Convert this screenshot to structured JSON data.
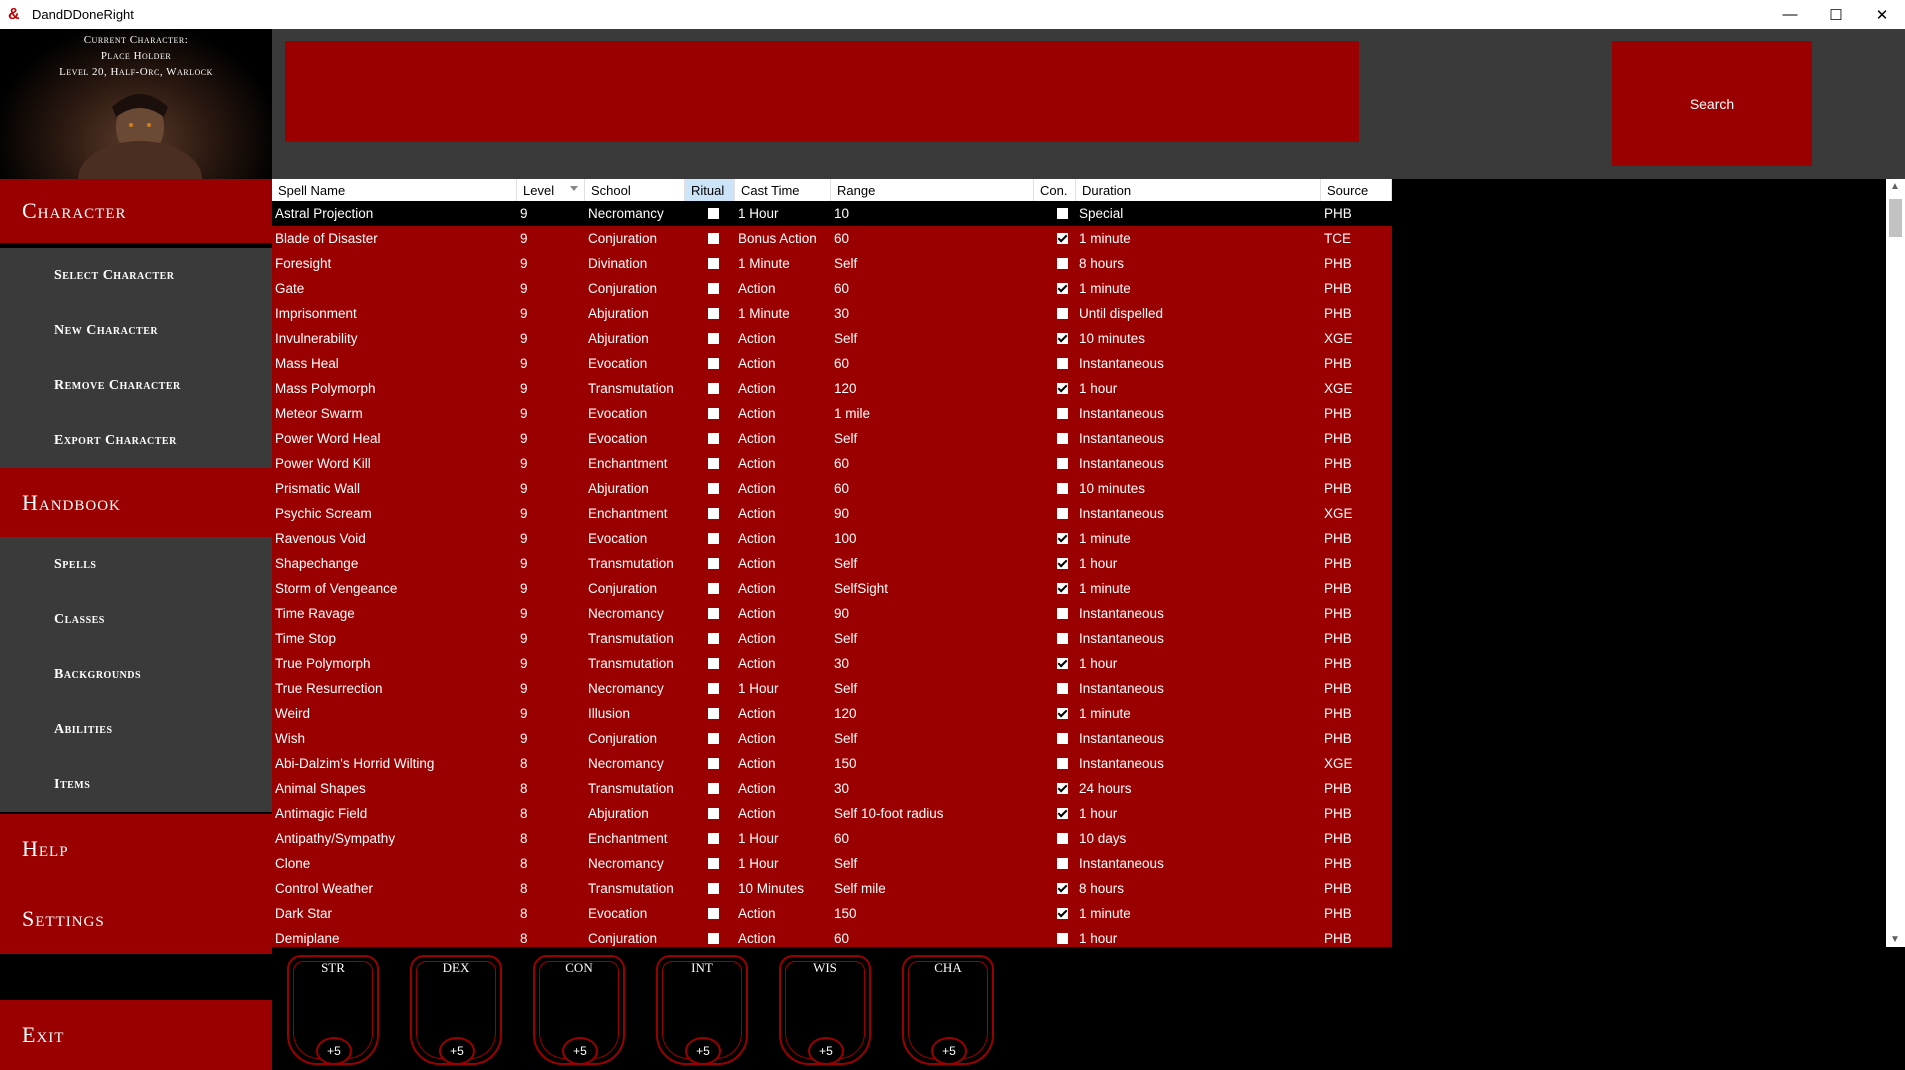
{
  "window": {
    "title": "DandDDoneRight",
    "minimize": "—",
    "maximize": "☐",
    "close": "✕"
  },
  "character": {
    "header": "Current Character:",
    "name": "Place Holder",
    "info": "Level 20, Half-Orc, Warlock"
  },
  "nav": {
    "character": "Character",
    "select_character": "Select Character",
    "new_character": "New Character",
    "remove_character": "Remove Character",
    "export_character": "Export Character",
    "handbook": "Handbook",
    "spells": "Spells",
    "classes": "Classes",
    "backgrounds": "Backgrounds",
    "abilities": "Abilities",
    "items": "Items",
    "help": "Help",
    "settings": "Settings",
    "exit": "Exit"
  },
  "search": {
    "value": "",
    "button": "Search"
  },
  "columns": [
    "Spell Name",
    "Level",
    "School",
    "Ritual",
    "Cast Time",
    "Range",
    "Con.",
    "Duration",
    "Source"
  ],
  "spells": [
    [
      "Astral Projection",
      "9",
      "Necromancy",
      false,
      "1 Hour",
      "10",
      false,
      "Special",
      "PHB"
    ],
    [
      "Blade of Disaster",
      "9",
      "Conjuration",
      false,
      "Bonus Action",
      "60",
      true,
      "1 minute",
      "TCE"
    ],
    [
      "Foresight",
      "9",
      "Divination",
      false,
      "1 Minute",
      "Self",
      false,
      "8 hours",
      "PHB"
    ],
    [
      "Gate",
      "9",
      "Conjuration",
      false,
      "Action",
      "60",
      true,
      "1 minute",
      "PHB"
    ],
    [
      "Imprisonment",
      "9",
      "Abjuration",
      false,
      "1 Minute",
      "30",
      false,
      "Until dispelled",
      "PHB"
    ],
    [
      "Invulnerability",
      "9",
      "Abjuration",
      false,
      "Action",
      "Self",
      true,
      "10 minutes",
      "XGE"
    ],
    [
      "Mass Heal",
      "9",
      "Evocation",
      false,
      "Action",
      "60",
      false,
      "Instantaneous",
      "PHB"
    ],
    [
      "Mass Polymorph",
      "9",
      "Transmutation",
      false,
      "Action",
      "120",
      true,
      "1 hour",
      "XGE"
    ],
    [
      "Meteor Swarm",
      "9",
      "Evocation",
      false,
      "Action",
      "1 mile",
      false,
      "Instantaneous",
      "PHB"
    ],
    [
      "Power Word Heal",
      "9",
      "Evocation",
      false,
      "Action",
      "Self",
      false,
      "Instantaneous",
      "PHB"
    ],
    [
      "Power Word Kill",
      "9",
      "Enchantment",
      false,
      "Action",
      "60",
      false,
      "Instantaneous",
      "PHB"
    ],
    [
      "Prismatic Wall",
      "9",
      "Abjuration",
      false,
      "Action",
      "60",
      false,
      "10 minutes",
      "PHB"
    ],
    [
      "Psychic Scream",
      "9",
      "Enchantment",
      false,
      "Action",
      "90",
      false,
      "Instantaneous",
      "XGE"
    ],
    [
      "Ravenous Void",
      "9",
      "Evocation",
      false,
      "Action",
      "100",
      true,
      "1 minute",
      "PHB"
    ],
    [
      "Shapechange",
      "9",
      "Transmutation",
      false,
      "Action",
      "Self",
      true,
      "1 hour",
      "PHB"
    ],
    [
      "Storm of Vengeance",
      "9",
      "Conjuration",
      false,
      "Action",
      "SelfSight",
      true,
      "1 minute",
      "PHB"
    ],
    [
      "Time Ravage",
      "9",
      "Necromancy",
      false,
      "Action",
      "90",
      false,
      "Instantaneous",
      "PHB"
    ],
    [
      "Time Stop",
      "9",
      "Transmutation",
      false,
      "Action",
      "Self",
      false,
      "Instantaneous",
      "PHB"
    ],
    [
      "True Polymorph",
      "9",
      "Transmutation",
      false,
      "Action",
      "30",
      true,
      "1 hour",
      "PHB"
    ],
    [
      "True Resurrection",
      "9",
      "Necromancy",
      false,
      "1 Hour",
      "Self",
      false,
      "Instantaneous",
      "PHB"
    ],
    [
      "Weird",
      "9",
      "Illusion",
      false,
      "Action",
      "120",
      true,
      "1 minute",
      "PHB"
    ],
    [
      "Wish",
      "9",
      "Conjuration",
      false,
      "Action",
      "Self",
      false,
      "Instantaneous",
      "PHB"
    ],
    [
      "Abi-Dalzim's Horrid Wilting",
      "8",
      "Necromancy",
      false,
      "Action",
      "150",
      false,
      "Instantaneous",
      "XGE"
    ],
    [
      "Animal Shapes",
      "8",
      "Transmutation",
      false,
      "Action",
      "30",
      true,
      "24 hours",
      "PHB"
    ],
    [
      "Antimagic Field",
      "8",
      "Abjuration",
      false,
      "Action",
      "Self 10-foot radius",
      true,
      "1 hour",
      "PHB"
    ],
    [
      "Antipathy/Sympathy",
      "8",
      "Enchantment",
      false,
      "1 Hour",
      "60",
      false,
      "10 days",
      "PHB"
    ],
    [
      "Clone",
      "8",
      "Necromancy",
      false,
      "1 Hour",
      "Self",
      false,
      "Instantaneous",
      "PHB"
    ],
    [
      "Control Weather",
      "8",
      "Transmutation",
      false,
      "10 Minutes",
      "Self mile",
      true,
      "8 hours",
      "PHB"
    ],
    [
      "Dark Star",
      "8",
      "Evocation",
      false,
      "Action",
      "150",
      true,
      "1 minute",
      "PHB"
    ],
    [
      "Demiplane",
      "8",
      "Conjuration",
      false,
      "Action",
      "60",
      false,
      "1 hour",
      "PHB"
    ]
  ],
  "stats": [
    {
      "name": "STR",
      "mod": "+5"
    },
    {
      "name": "DEX",
      "mod": "+5"
    },
    {
      "name": "CON",
      "mod": "+5"
    },
    {
      "name": "INT",
      "mod": "+5"
    },
    {
      "name": "WIS",
      "mod": "+5"
    },
    {
      "name": "CHA",
      "mod": "+5"
    }
  ],
  "colors": {
    "accent": "#9b0000",
    "panel": "#3a3a3a",
    "background": "#000000"
  }
}
